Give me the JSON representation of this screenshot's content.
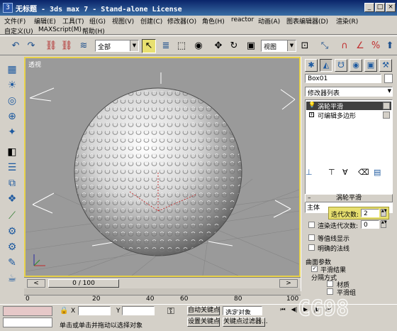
{
  "window": {
    "title": "无标题 - 3ds max 7 - Stand-alone License",
    "app_icon": "3ds-max-icon",
    "controls": [
      "minimize",
      "maximize",
      "close"
    ]
  },
  "menu1": [
    "文件(F)",
    "编辑(E)",
    "工具(T)",
    "组(G)",
    "视图(V)",
    "创建(C)",
    "修改器(O)",
    "角色(H)",
    "reactor",
    "动画(A)",
    "图表编辑器(D)",
    "渲染(R)"
  ],
  "menu2": [
    "自定义(U)",
    "MAXScript(M)",
    "帮助(H)"
  ],
  "toolbar": {
    "selection_filter": "全部",
    "ref_coord": "视图"
  },
  "viewport": {
    "label": "透视"
  },
  "command_panel": {
    "object_name": "Box01",
    "modifier_list": "修改器列表",
    "stack": [
      {
        "label": "涡轮平滑",
        "selected": true
      },
      {
        "label": "可编辑多边形",
        "selected": false
      }
    ],
    "rollout_title": "涡轮平滑",
    "main_label": "主体",
    "iterations_label": "迭代次数:",
    "iterations_value": "2",
    "render_iters_label": "渲染迭代次数:",
    "render_iters_value": "0",
    "isoline_label": "等值线显示",
    "explicit_normals_label": "明确的法线",
    "surface_params_label": "曲面参数",
    "smooth_result_label": "平滑结果",
    "separate_label": "分隔方式",
    "material_label": "材质",
    "smoothing_groups_label": "平滑组"
  },
  "timeline": {
    "frame_readout": "0 / 100",
    "ticks": [
      "0",
      "20",
      "40",
      "60",
      "80",
      "100"
    ]
  },
  "status": {
    "prompt": "单击或单击并拖动以选择对象",
    "auto_key": "自动关键点",
    "set_key": "设置关键点",
    "selected_label": "选定对象",
    "key_filters": "关键点过滤器..."
  },
  "watermark": "CG98",
  "colors": {
    "titlebar": "#0a246a",
    "viewport_bg": "#9a9a9a",
    "viewport_border": "#e8d24a",
    "highlight_field": "#e8e070",
    "autokey_red": "#c03030"
  }
}
